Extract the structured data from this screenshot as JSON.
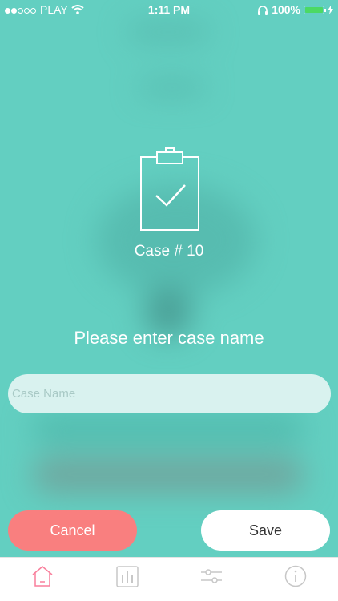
{
  "status_bar": {
    "carrier": "PLAY",
    "time": "1:11 PM",
    "battery": "100%",
    "battery_level": 1.0,
    "signal_bars_filled": 2,
    "signal_bars_total": 5
  },
  "dialog": {
    "icon": "clipboard-check-icon",
    "case_title": "Case # 10",
    "prompt": "Please enter case name",
    "input_placeholder": "Case Name",
    "input_value": ""
  },
  "buttons": {
    "cancel_label": "Cancel",
    "save_label": "Save"
  },
  "tab_bar": {
    "items": [
      {
        "icon": "home-icon",
        "active": true
      },
      {
        "icon": "bar-chart-icon",
        "active": false
      },
      {
        "icon": "sliders-icon",
        "active": false
      },
      {
        "icon": "info-icon",
        "active": false
      }
    ]
  },
  "colors": {
    "background": "#63cfc1",
    "cancel": "#f97f7f",
    "save": "#ffffff",
    "tab_active": "#f97f9c",
    "tab_inactive": "#c7c7c7"
  }
}
